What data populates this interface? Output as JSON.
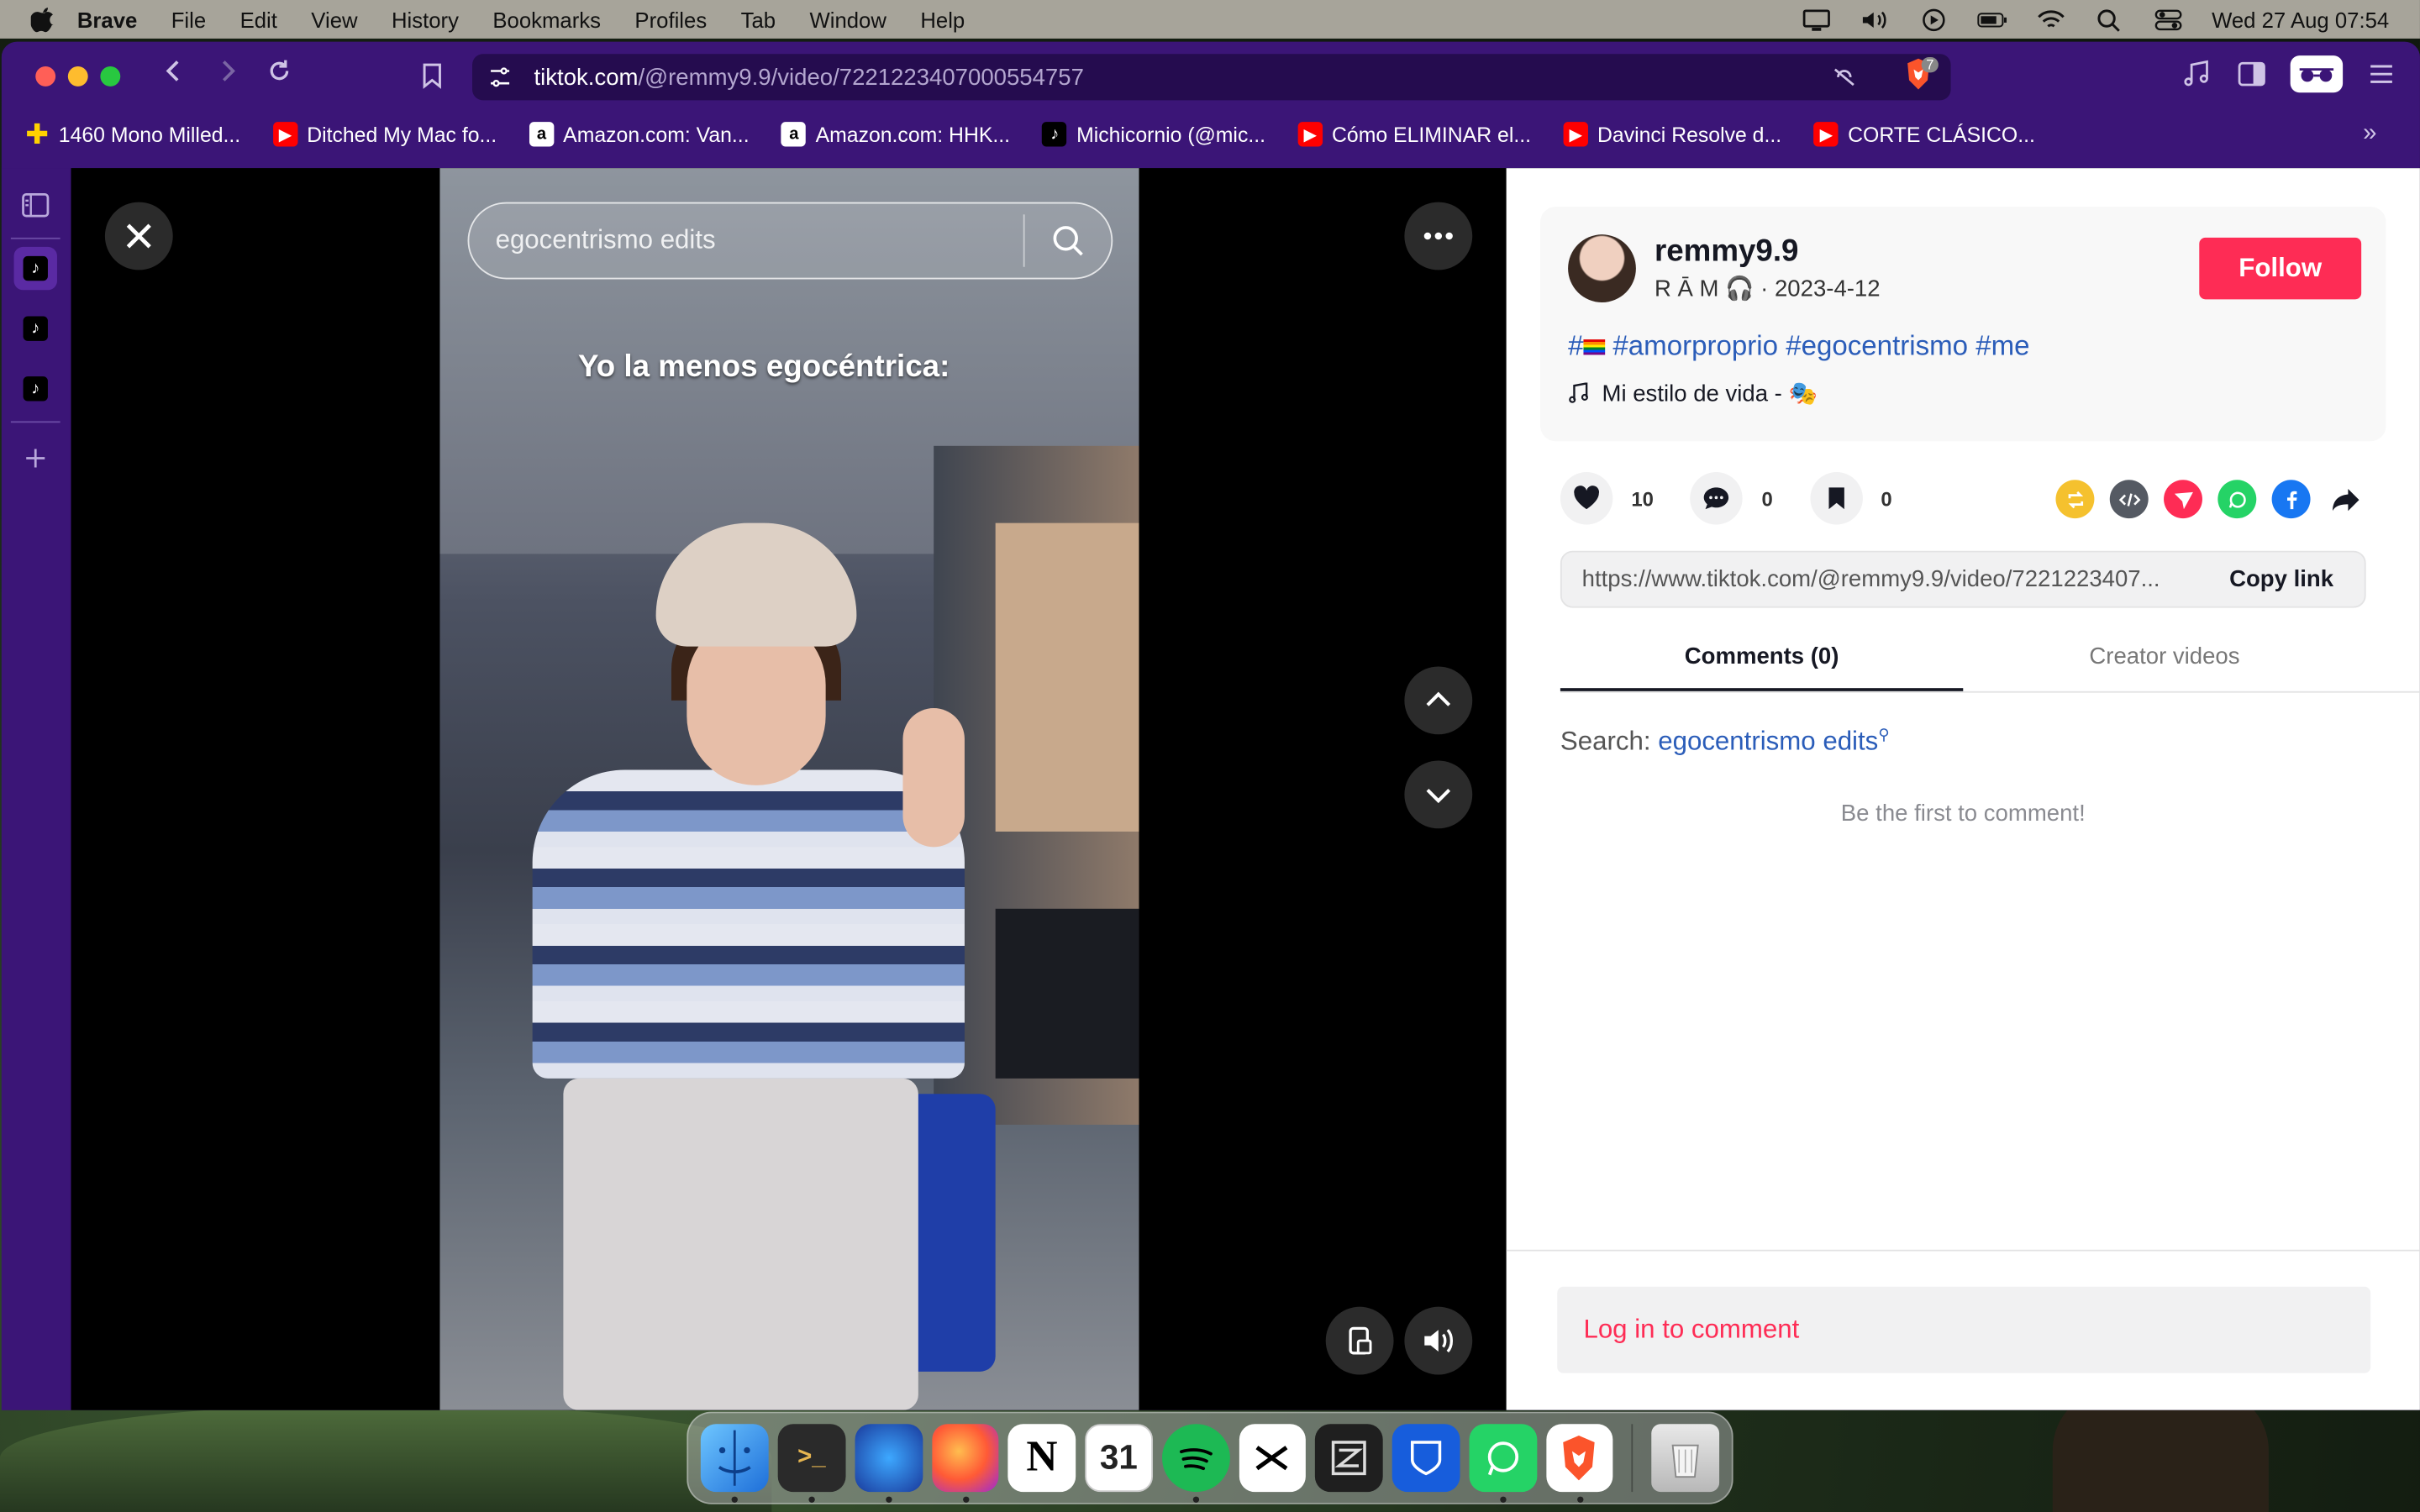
{
  "menubar": {
    "app_name": "Brave",
    "items": [
      "File",
      "Edit",
      "View",
      "History",
      "Bookmarks",
      "Profiles",
      "Tab",
      "Window",
      "Help"
    ],
    "clock": "Wed 27 Aug  07:54"
  },
  "browser": {
    "url_host": "tiktok.com",
    "url_path": "/@remmy9.9/video/7221223407000554757",
    "shields_count": "7",
    "bookmarks": [
      {
        "label": "1460 Mono Milled...",
        "icon": "plus-icon"
      },
      {
        "label": "Ditched My Mac fo...",
        "icon": "youtube-icon"
      },
      {
        "label": "Amazon.com: Van...",
        "icon": "amazon-icon"
      },
      {
        "label": "Amazon.com: HHK...",
        "icon": "amazon-icon"
      },
      {
        "label": "Michicornio (@mic...",
        "icon": "tiktok-icon"
      },
      {
        "label": "Cómo ELIMINAR el...",
        "icon": "youtube-icon"
      },
      {
        "label": "Davinci Resolve d...",
        "icon": "youtube-icon"
      },
      {
        "label": "CORTE CLÁSICO...",
        "icon": "youtube-icon"
      }
    ],
    "bookmarks_more": "»"
  },
  "video": {
    "search_query": "egocentrismo edits",
    "overlay_caption": "Yo la menos egocéntrica:"
  },
  "post": {
    "username": "remmy9.9",
    "display_name": "R Ā M",
    "date": "2023-4-12",
    "follow_label": "Follow",
    "hashtags": "#amorproprio #egocentrismo #me",
    "hashtag_prefix": "#",
    "music": "Mi estilo de vida - 🎭",
    "likes": "10",
    "comments": "0",
    "saves": "0",
    "share_link": "https://www.tiktok.com/@remmy9.9/video/7221223407...",
    "copy_label": "Copy link"
  },
  "tabs": {
    "comments": "Comments (0)",
    "creator": "Creator videos"
  },
  "comments": {
    "search_label": "Search:",
    "search_keyword": "egocentrismo edits",
    "empty_text": "Be the first to comment!",
    "login_label": "Log in to comment"
  },
  "colors": {
    "brave_frame": "#3b1577",
    "tiktok_red": "#fe2c55",
    "link_blue": "#2b5db9"
  },
  "dock": {
    "apps": [
      "Finder",
      "Terminal",
      "Firefox Dev",
      "Firefox",
      "Notion",
      "Calendar",
      "Spotify",
      "CapCut",
      "Zed",
      "Bitwarden",
      "WhatsApp",
      "Brave",
      "Trash"
    ],
    "calendar_day": "31",
    "notion_letter": "N"
  }
}
